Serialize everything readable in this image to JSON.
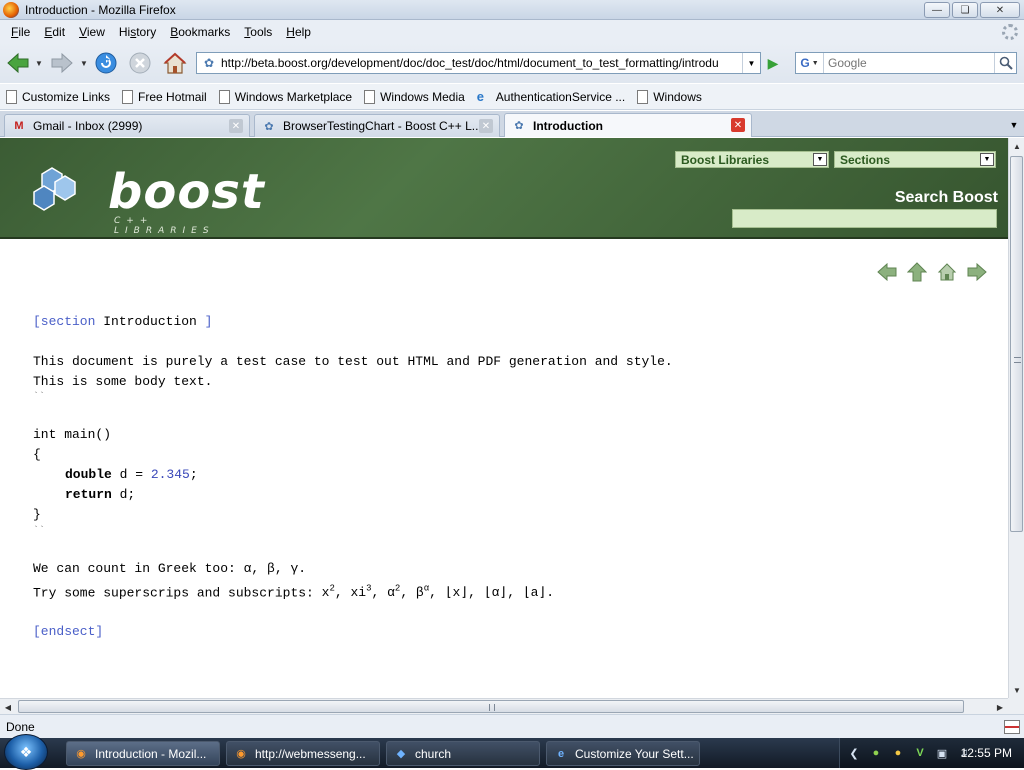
{
  "window": {
    "title": "Introduction - Mozilla Firefox"
  },
  "menu": [
    "File",
    "Edit",
    "View",
    "History",
    "Bookmarks",
    "Tools",
    "Help"
  ],
  "menu_underline": [
    "F",
    "E",
    "V",
    "s",
    "B",
    "T",
    "H"
  ],
  "nav": {
    "url": "http://beta.boost.org/development/doc/doc_test/doc/html/document_to_test_formatting/introdu",
    "search_placeholder": "Google",
    "search_engine": "G"
  },
  "bookmarks": [
    {
      "label": "Customize Links",
      "icon": "page-icon"
    },
    {
      "label": "Free Hotmail",
      "icon": "page-icon"
    },
    {
      "label": "Windows Marketplace",
      "icon": "page-icon"
    },
    {
      "label": "Windows Media",
      "icon": "page-icon"
    },
    {
      "label": "AuthenticationService ...",
      "icon": "ie-icon"
    },
    {
      "label": "Windows",
      "icon": "page-icon"
    }
  ],
  "tabs": [
    {
      "label": "Gmail - Inbox (2999)",
      "icon": "gmail-icon",
      "active": false
    },
    {
      "label": "BrowserTestingChart - Boost C++ L...",
      "icon": "boost-icon",
      "active": false
    },
    {
      "label": "Introduction",
      "icon": "boost-icon",
      "active": true
    }
  ],
  "boost": {
    "logo_text": "boost",
    "logo_sub": "C++ LIBRARIES",
    "libraries_select": "Boost Libraries",
    "sections_select": "Sections",
    "search_title": "Search Boost"
  },
  "doc": {
    "section_open": "[section",
    "section_title": "Introduction",
    "section_close": "]",
    "para1": "This document is purely a test case to test out HTML and PDF generation and style.",
    "para2": "This is some body text.",
    "code_fence": "``",
    "code_line1_kw": "int",
    "code_line1_rest": " main()",
    "code_open": "{",
    "code_line3_kw": "double",
    "code_line3_rest": " d = ",
    "code_line3_num": "2.345",
    "code_line3_end": ";",
    "code_line4_kw": "return",
    "code_line4_rest": " d;",
    "code_close": "}",
    "greek": "We can count in Greek too: α, β, γ.",
    "super_prefix": "Try some superscrips and subscripts: ",
    "endsect": "[endsect]"
  },
  "status": {
    "text": "Done"
  },
  "taskbar": {
    "tasks": [
      {
        "label": "Introduction - Mozil...",
        "icon": "firefox-icon",
        "active": true
      },
      {
        "label": "http://webmesseng...",
        "icon": "firefox-icon",
        "active": false
      },
      {
        "label": "church",
        "icon": "diamond-icon",
        "active": false
      },
      {
        "label": "Customize Your Sett...",
        "icon": "ie-icon",
        "active": false
      }
    ],
    "clock": "12:55 PM"
  }
}
